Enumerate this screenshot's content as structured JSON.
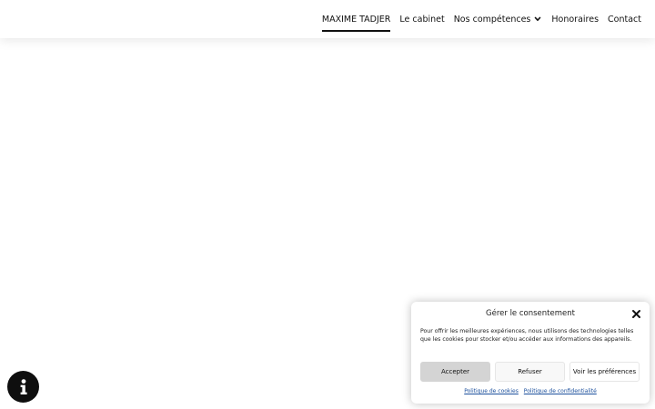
{
  "nav": {
    "items": [
      {
        "label": "MAXIME TADJER",
        "active": true
      },
      {
        "label": "Le cabinet",
        "active": false
      },
      {
        "label": "Nos compétences",
        "active": false,
        "dropdown": true
      },
      {
        "label": "Honoraires",
        "active": false
      },
      {
        "label": "Contact",
        "active": false
      }
    ]
  },
  "info_button": {
    "icon": "info-icon"
  },
  "consent": {
    "title": "Gérer le consentement",
    "message": "Pour offrir les meilleures expériences, nous utilisons des technologies telles que les cookies pour stocker et/ou accéder aux informations des appareils.",
    "accept_label": "Accepter",
    "refuse_label": "Refuser",
    "prefs_label": "Voir les préférences",
    "cookie_policy_label": "Politique de cookies",
    "privacy_policy_label": "Politique de confidentialité"
  },
  "colors": {
    "accent": "#111111",
    "link": "#1b4f9c",
    "accept_bg": "#d4d4d4"
  }
}
